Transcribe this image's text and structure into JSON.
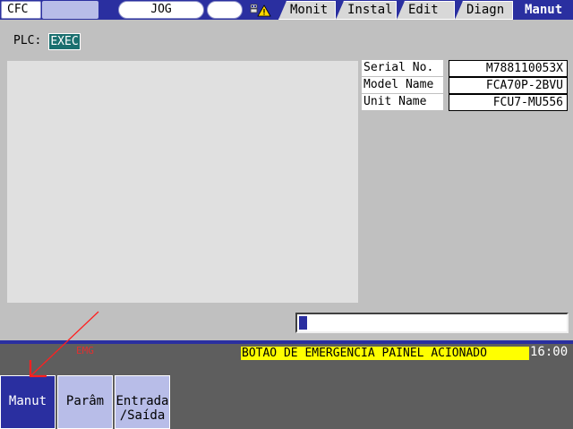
{
  "header": {
    "system_label": "CFC",
    "mode_label": "JOG",
    "tabs": [
      {
        "label": "Monit",
        "active": false
      },
      {
        "label": "Instal",
        "active": false
      },
      {
        "label": "Edit",
        "active": false
      },
      {
        "label": "Diagn",
        "active": false
      },
      {
        "label": "Manut",
        "active": true
      }
    ],
    "alarm_icon": "warning-icon"
  },
  "plc": {
    "label": "PLC:",
    "value": "EXEC"
  },
  "info": {
    "rows": [
      {
        "label": "Serial No.",
        "value": "M788110053X"
      },
      {
        "label": "Model Name",
        "value": "FCA70P-2BVU"
      },
      {
        "label": "Unit Name",
        "value": "FCU7-MU556"
      }
    ]
  },
  "progress": {
    "fraction": 0.03
  },
  "status": {
    "emg": "EMG",
    "message": "BOTAO DE EMERGENCIA PAINEL ACIONADO",
    "clock": "16:00"
  },
  "softkeys": [
    {
      "line1": "Manut",
      "line2": "",
      "active": true
    },
    {
      "line1": "Parâm",
      "line2": "",
      "active": false
    },
    {
      "line1": "Entrada",
      "line2": "/Saída",
      "active": false
    }
  ],
  "colors": {
    "bar_blue": "#2a2fa0",
    "plc_exec_bg": "#1a6f6f",
    "alarm_yellow": "#ffff00",
    "annotation_red": "#ff2020"
  }
}
